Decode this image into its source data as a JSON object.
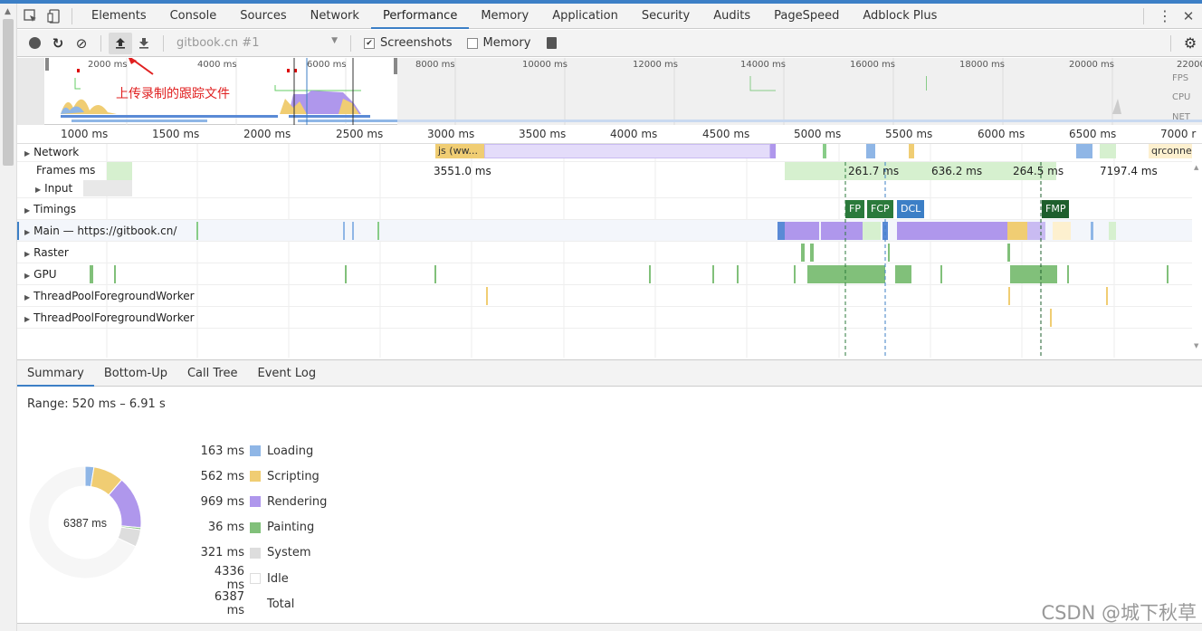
{
  "tabs": [
    "Elements",
    "Console",
    "Sources",
    "Network",
    "Performance",
    "Memory",
    "Application",
    "Security",
    "Audits",
    "PageSpeed",
    "Adblock Plus"
  ],
  "active_tab": "Performance",
  "toolbar": {
    "profile_select": "gitbook.cn #1",
    "screenshots_label": "Screenshots",
    "screenshots_checked": true,
    "memory_label": "Memory",
    "memory_checked": false
  },
  "annotation": "上传录制的跟踪文件",
  "overview": {
    "ticks": [
      "2000 ms",
      "4000 ms",
      "6000 ms",
      "8000 ms",
      "10000 ms",
      "12000 ms",
      "14000 ms",
      "16000 ms",
      "18000 ms",
      "20000 ms",
      "22000"
    ],
    "lanes": [
      "FPS",
      "CPU",
      "NET"
    ]
  },
  "ruler": [
    "1000 ms",
    "1500 ms",
    "2000 ms",
    "2500 ms",
    "3000 ms",
    "3500 ms",
    "4000 ms",
    "4500 ms",
    "5000 ms",
    "5500 ms",
    "6000 ms",
    "6500 ms",
    "7000 r"
  ],
  "tracks": {
    "network": "Network",
    "network_items": [
      "js (ww...",
      "qrconne"
    ],
    "frames": "Frames",
    "frames_ms": "ms",
    "frame_times": [
      "3551.0 ms",
      "261.7 ms",
      "636.2 ms",
      "264.5 ms",
      "7197.4 ms"
    ],
    "input": "Input",
    "timings": "Timings",
    "main": "Main — https://gitbook.cn/",
    "raster": "Raster",
    "gpu": "GPU",
    "worker1": "ThreadPoolForegroundWorker",
    "worker2": "ThreadPoolForegroundWorker"
  },
  "markers": [
    "FP",
    "FCP",
    "DCL",
    "FMP"
  ],
  "bottom_tabs": [
    "Summary",
    "Bottom-Up",
    "Call Tree",
    "Event Log"
  ],
  "summary": {
    "range": "Range: 520 ms – 6.91 s",
    "total_center": "6387 ms",
    "rows": [
      {
        "value": "163 ms",
        "label": "Loading",
        "color": "#8fb6e6",
        "ms": 163
      },
      {
        "value": "562 ms",
        "label": "Scripting",
        "color": "#f0cd73",
        "ms": 562
      },
      {
        "value": "969 ms",
        "label": "Rendering",
        "color": "#af97ec",
        "ms": 969
      },
      {
        "value": "36 ms",
        "label": "Painting",
        "color": "#81c07a",
        "ms": 36
      },
      {
        "value": "321 ms",
        "label": "System",
        "color": "#dddddd",
        "ms": 321
      },
      {
        "value": "4336 ms",
        "label": "Idle",
        "color": "#ffffff",
        "ms": 4336
      },
      {
        "value": "6387 ms",
        "label": "Total",
        "color": "",
        "ms": 6387
      }
    ]
  },
  "watermark": "CSDN @城下秋草"
}
